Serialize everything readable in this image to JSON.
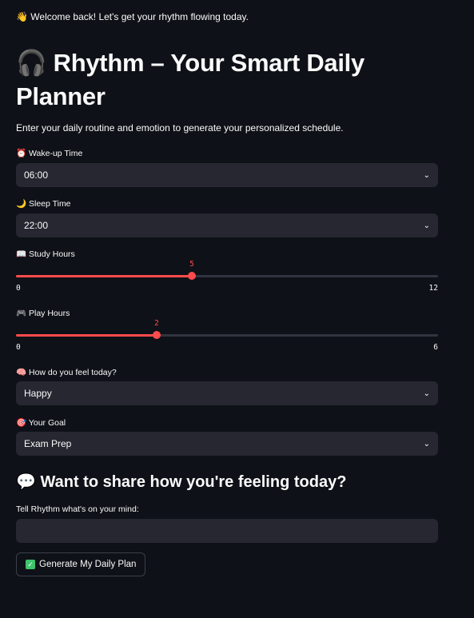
{
  "welcome": {
    "icon": "👋",
    "text": "Welcome back! Let's get your rhythm flowing today."
  },
  "title": {
    "icon": "🎧",
    "text": "Rhythm – Your Smart Daily Planner"
  },
  "subtitle": "Enter your daily routine and emotion to generate your personalized schedule.",
  "wake": {
    "icon": "⏰",
    "label": "Wake-up Time",
    "value": "06:00"
  },
  "sleep": {
    "icon": "🌙",
    "label": "Sleep Time",
    "value": "22:00"
  },
  "study": {
    "icon": "📖",
    "label": "Study Hours",
    "value": "5",
    "min": "0",
    "max": "12"
  },
  "play": {
    "icon": "🎮",
    "label": "Play Hours",
    "value": "2",
    "min": "0",
    "max": "6"
  },
  "feel": {
    "icon": "🧠",
    "label": "How do you feel today?",
    "value": "Happy"
  },
  "goal": {
    "icon": "🎯",
    "label": "Your Goal",
    "value": "Exam Prep"
  },
  "share": {
    "icon": "💬",
    "heading": "Want to share how you're feeling today?",
    "label": "Tell Rhythm what's on your mind:",
    "value": ""
  },
  "button": {
    "icon": "✓",
    "label": "Generate My Daily Plan"
  },
  "colors": {
    "background": "#0e1117",
    "accent": "#ff4b4b",
    "field": "#262730"
  }
}
